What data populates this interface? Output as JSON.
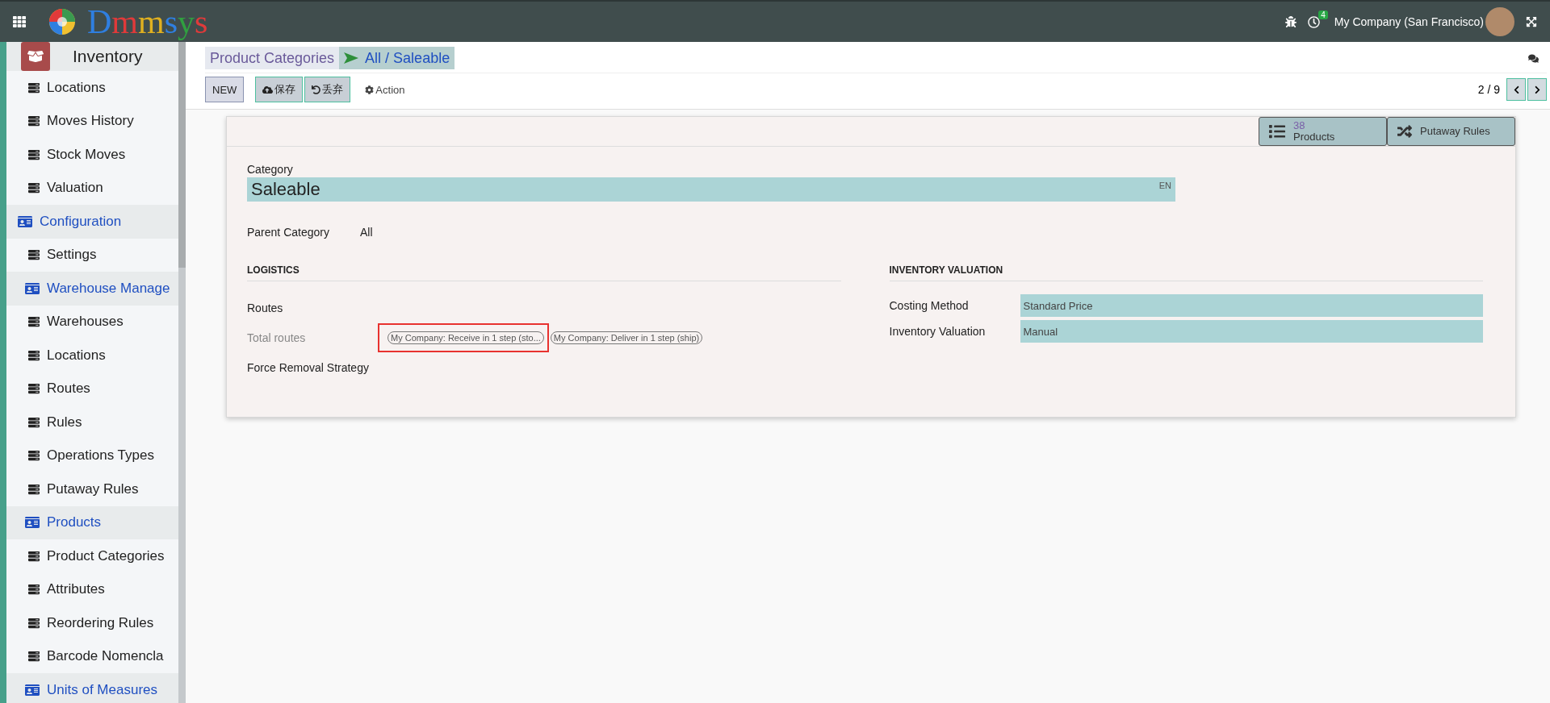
{
  "topbar": {
    "logo": "Dmmsys",
    "activity_count": "4",
    "company": "My Company (San Francisco)"
  },
  "sidebar": {
    "app_title": "Inventory",
    "items": [
      {
        "kind": "item",
        "label": "Locations"
      },
      {
        "kind": "item",
        "label": "Moves History"
      },
      {
        "kind": "item",
        "label": "Stock Moves"
      },
      {
        "kind": "item",
        "label": "Valuation"
      },
      {
        "kind": "section",
        "label": "Configuration",
        "children": [
          {
            "kind": "item",
            "label": "Settings"
          },
          {
            "kind": "section",
            "label": "Warehouse Manage",
            "children": [
              {
                "kind": "item",
                "label": "Warehouses"
              },
              {
                "kind": "item",
                "label": "Locations"
              },
              {
                "kind": "item",
                "label": "Routes"
              },
              {
                "kind": "item",
                "label": "Rules"
              },
              {
                "kind": "item",
                "label": "Operations Types"
              },
              {
                "kind": "item",
                "label": "Putaway Rules"
              }
            ]
          },
          {
            "kind": "section",
            "label": "Products",
            "children": [
              {
                "kind": "item",
                "label": "Product Categories"
              },
              {
                "kind": "item",
                "label": "Attributes"
              },
              {
                "kind": "item",
                "label": "Reordering Rules"
              },
              {
                "kind": "item",
                "label": "Barcode Nomencla"
              }
            ]
          },
          {
            "kind": "section",
            "label": "Units of Measures"
          }
        ]
      }
    ]
  },
  "breadcrumb": [
    {
      "label": "Product Categories",
      "selected": false
    },
    {
      "label": "All / Saleable",
      "selected": true
    }
  ],
  "toolbar": {
    "buttons": [
      {
        "kind": "new",
        "label": "NEW"
      },
      {
        "kind": "save",
        "label": "保存"
      },
      {
        "kind": "discard",
        "label": "丢弃"
      },
      {
        "kind": "action",
        "label": "Action"
      }
    ],
    "pager": "2 / 9"
  },
  "smart_buttons": [
    {
      "kind": "products",
      "count": "38",
      "label": "Products"
    },
    {
      "kind": "putaway",
      "label": "Putaway Rules"
    }
  ],
  "form": {
    "category_label": "Category",
    "name": "Saleable",
    "lang": "EN",
    "parent_label": "Parent Category",
    "parent_value": "All",
    "logistics": {
      "title": "LOGISTICS",
      "fields": [
        {
          "label": "Routes",
          "disabled": false
        },
        {
          "label": "Total routes",
          "disabled": true,
          "tags": [
            {
              "label": "My Company: Receive in 1 step (sto...",
              "highlighted": true
            },
            {
              "label": "My Company: Deliver in 1 step (ship)",
              "highlighted": false
            }
          ]
        },
        {
          "label": "Force Removal Strategy",
          "disabled": false
        }
      ]
    },
    "valuation": {
      "title": "INVENTORY VALUATION",
      "fields": [
        {
          "label": "Costing Method",
          "value": "Standard Price"
        },
        {
          "label": "Inventory Valuation",
          "value": "Manual"
        }
      ]
    }
  }
}
